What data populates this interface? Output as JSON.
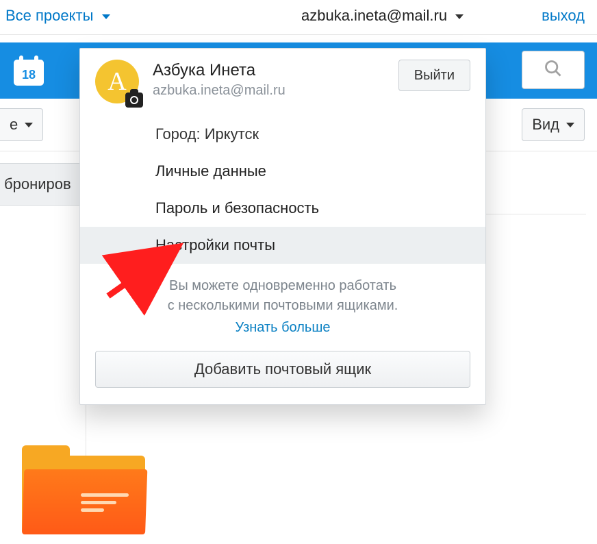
{
  "top": {
    "all_projects": "Все проекты",
    "email": "azbuka.ineta@mail.ru",
    "logout": "выход"
  },
  "calendar_day": "18",
  "toolbar": {
    "left_dd_tail": "е",
    "view_label": "Вид"
  },
  "left_chip": "брониров",
  "pop": {
    "avatar_letter": "A",
    "name": "Азбука Инета",
    "email": "azbuka.ineta@mail.ru",
    "exit": "Выйти",
    "city_label": "Город: Иркутск",
    "items": {
      "personal": "Личные данные",
      "security": "Пароль и безопасность",
      "mail_settings": "Настройки почты"
    },
    "hint_line1": "Вы можете одновременно работать",
    "hint_line2": "с несколькими почтовыми ящиками.",
    "learn_more": "Узнать больше",
    "add_mailbox": "Добавить почтовый ящик"
  }
}
